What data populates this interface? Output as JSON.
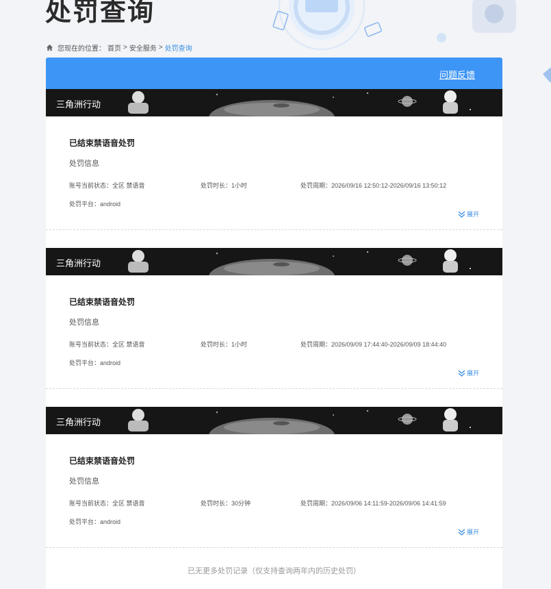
{
  "page": {
    "title": "处罚查询"
  },
  "breadcrumb": {
    "prefix": "您现在的位置：",
    "items": [
      "首页",
      "安全服务",
      "处罚查询"
    ],
    "separator": ">"
  },
  "topbar": {
    "feedback_label": "问题反馈"
  },
  "records": [
    {
      "game": "三角洲行动",
      "status": "已结束禁语音处罚",
      "section": "处罚信息",
      "account_status": "账号当前状态：全区 禁语音",
      "duration": "处罚时长：1小时",
      "period": "处罚周期：2026/09/16 12:50:12-2026/09/16 13:50:12",
      "platform": "处罚平台：android",
      "expand": "展开"
    },
    {
      "game": "三角洲行动",
      "status": "已结束禁语音处罚",
      "section": "处罚信息",
      "account_status": "账号当前状态：全区 禁语音",
      "duration": "处罚时长：1小时",
      "period": "处罚周期：2026/09/09 17:44:40-2026/09/09 18:44:40",
      "platform": "处罚平台：android",
      "expand": "展开"
    },
    {
      "game": "三角洲行动",
      "status": "已结束禁语音处罚",
      "section": "处罚信息",
      "account_status": "账号当前状态：全区 禁语音",
      "duration": "处罚时长：30分钟",
      "period": "处罚周期：2026/09/06 14:11:59-2026/09/06 14:41:59",
      "platform": "处罚平台：android",
      "expand": "展开"
    }
  ],
  "footer": {
    "note": "已无更多处罚记录（仅支持查询两年内的历史处罚）"
  },
  "colors": {
    "accent": "#3d95f6",
    "link": "#3b8fe0",
    "banner": "#161616"
  }
}
